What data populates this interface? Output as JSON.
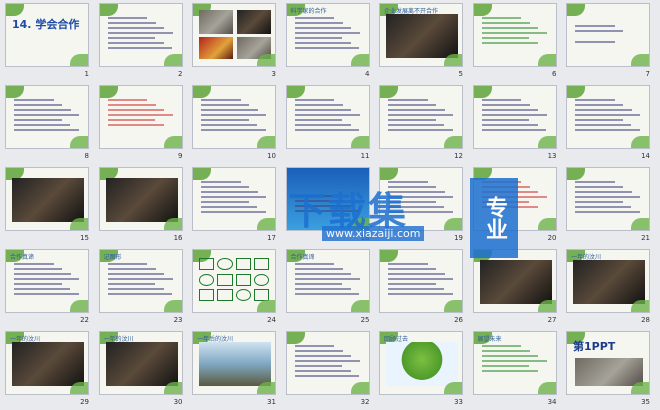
{
  "slides": [
    {
      "n": "1",
      "title": "14. 学会合作",
      "kind": "title"
    },
    {
      "n": "2",
      "kind": "text"
    },
    {
      "n": "3",
      "kind": "photos"
    },
    {
      "n": "4",
      "caption": "科学家的合作",
      "kind": "text"
    },
    {
      "n": "5",
      "caption": "企业发展离不开合作",
      "kind": "photo"
    },
    {
      "n": "6",
      "kind": "greentext"
    },
    {
      "n": "7",
      "kind": "vocab"
    },
    {
      "n": "8",
      "kind": "text"
    },
    {
      "n": "9",
      "kind": "redtext"
    },
    {
      "n": "10",
      "kind": "text"
    },
    {
      "n": "11",
      "kind": "text"
    },
    {
      "n": "12",
      "kind": "text"
    },
    {
      "n": "13",
      "kind": "text"
    },
    {
      "n": "14",
      "kind": "text"
    },
    {
      "n": "15",
      "kind": "photo"
    },
    {
      "n": "16",
      "kind": "photo"
    },
    {
      "n": "17",
      "kind": "text"
    },
    {
      "n": "18",
      "kind": "blue"
    },
    {
      "n": "19",
      "kind": "text"
    },
    {
      "n": "20",
      "kind": "redtext"
    },
    {
      "n": "21",
      "kind": "text"
    },
    {
      "n": "22",
      "caption": "合作真谛",
      "kind": "text"
    },
    {
      "n": "23",
      "caption": "记图形",
      "kind": "text"
    },
    {
      "n": "24",
      "kind": "shapes"
    },
    {
      "n": "25",
      "caption": "合作真谛",
      "kind": "text"
    },
    {
      "n": "26",
      "kind": "text"
    },
    {
      "n": "27",
      "kind": "photo"
    },
    {
      "n": "28",
      "caption": "一年的汶川",
      "kind": "photo"
    },
    {
      "n": "29",
      "caption": "一年的汶川",
      "kind": "photo"
    },
    {
      "n": "30",
      "caption": "一年的汶川",
      "kind": "photo"
    },
    {
      "n": "31",
      "caption": "一年后的汶川",
      "kind": "water"
    },
    {
      "n": "32",
      "kind": "text"
    },
    {
      "n": "33",
      "caption": "回顾过去",
      "kind": "tree"
    },
    {
      "n": "34",
      "caption": "展望未来",
      "kind": "greentext"
    },
    {
      "n": "35",
      "logo": "第1PPT",
      "kind": "logo"
    }
  ],
  "watermark": {
    "main": "下载集",
    "url": "www.xiazaiji.com",
    "side": "专业"
  }
}
